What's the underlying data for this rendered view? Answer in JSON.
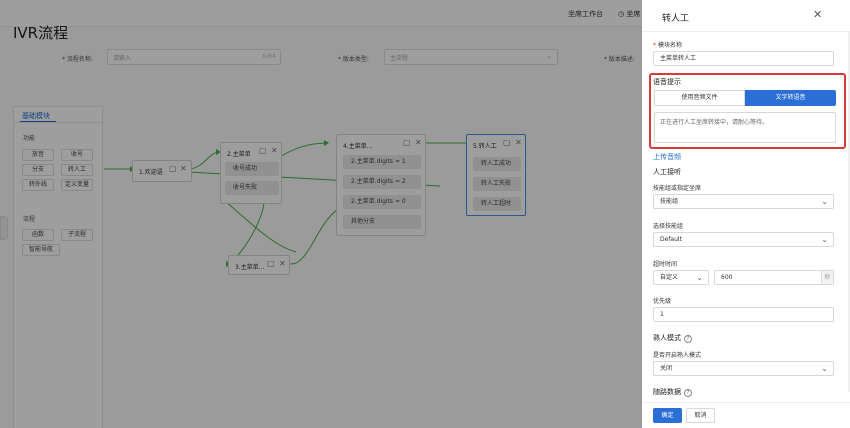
{
  "topbar": {
    "workbench": "坐席工作台",
    "status_prefix": "坐席"
  },
  "page_title": "IVR流程",
  "form": {
    "flow_name_label": "* 流程名称:",
    "flow_name_placeholder": "请输入",
    "flow_name_count": "0/64",
    "version_type_label": "* 版本类型:",
    "version_type_placeholder": "主流程",
    "version_desc_label": "* 版本描述:"
  },
  "palette": {
    "tab": "基础模块",
    "section_function": "功能",
    "function_items": [
      "放音",
      "收号",
      "分支",
      "转人工",
      "转外线",
      "定义变量"
    ],
    "section_flow": "流程",
    "flow_items": [
      "函数",
      "子流程",
      "智能导航"
    ]
  },
  "canvas": {
    "node1": {
      "title": "1.欢迎语"
    },
    "node2": {
      "title": "2.主菜单",
      "ports": [
        "收号成功",
        "收号失败"
      ]
    },
    "node3": {
      "title": "3.主菜单..."
    },
    "node4": {
      "title": "4.主菜单...",
      "ports": [
        "2.主菜单.digits = 1",
        "2.主菜单.digits = 2",
        "2.主菜单.digits = 0",
        "其他分支"
      ]
    },
    "node5": {
      "title": "5.转人工",
      "ports": [
        "转人工成功",
        "转人工失败",
        "转人工超时"
      ]
    }
  },
  "drawer": {
    "title": "转人工",
    "module_name_label": "模块名称",
    "module_name_value": "主菜单转人工",
    "voice_prompt_label": "语音提示",
    "seg_audio": "使用音频文件",
    "seg_tts": "文字转语音",
    "tts_text": "正在进行人工坐席转接中，请耐心等待。",
    "upload_link": "上传音频",
    "agent_section": "人工接听",
    "skill_label": "技能组或指定坐席",
    "skill_value": "技能组",
    "group_label": "选择技能组",
    "group_value": "Default",
    "timeout_label": "超时时间",
    "timeout_mode": "自定义",
    "timeout_value": "600",
    "timeout_unit": "秒",
    "priority_label": "优先级",
    "priority_value": "1",
    "familiar_section": "熟人模式",
    "familiar_toggle_label": "是否开启熟人模式",
    "familiar_value": "关闭",
    "follow_section": "随路数据",
    "ok_button": "确定",
    "cancel_button": "取消"
  },
  "colors": {
    "accent": "#2b6fd6",
    "highlight": "#d43b3b",
    "wire": "#4caf50"
  }
}
